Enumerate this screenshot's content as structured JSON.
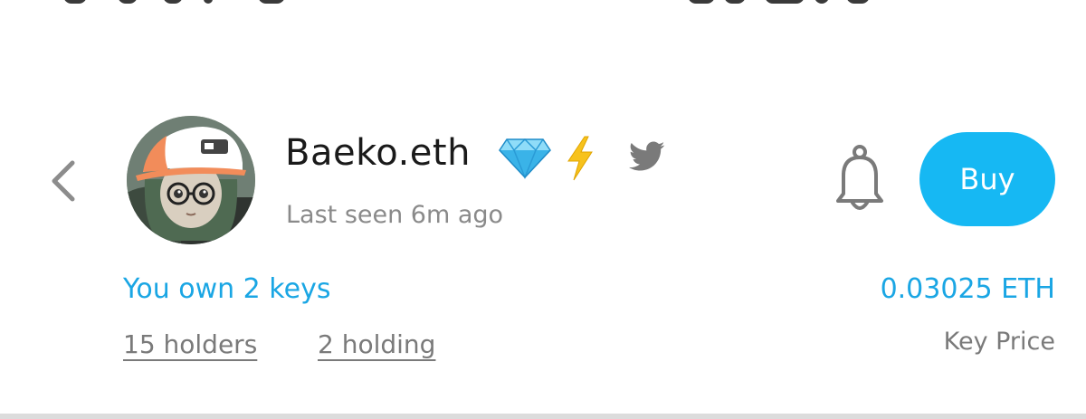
{
  "profile": {
    "name": "Baeko.eth",
    "last_seen": "Last seen 6m ago",
    "badges": [
      "diamond-icon",
      "lightning-icon"
    ],
    "social": "twitter-icon"
  },
  "actions": {
    "back_icon": "chevron-left-icon",
    "notify_icon": "bell-icon",
    "buy_label": "Buy"
  },
  "stats": {
    "keys_owned": "You own 2 keys",
    "holders": "15 holders",
    "holding": "2 holding"
  },
  "price": {
    "value": "0.03025 ETH",
    "label": "Key Price"
  },
  "colors": {
    "accent": "#16b8f3",
    "accent_text": "#1aa6e4",
    "muted_text": "#8a8a8a"
  }
}
